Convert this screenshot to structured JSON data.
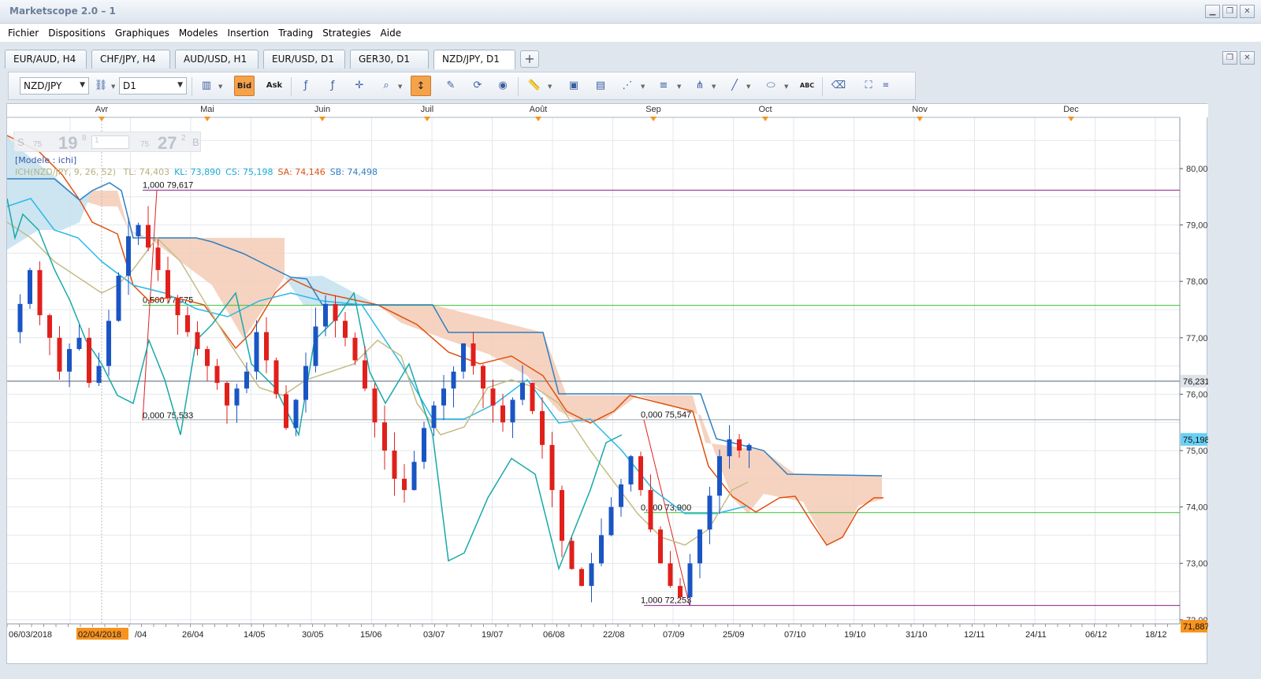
{
  "window": {
    "title": "Marketscope 2.0 – 1"
  },
  "menu": [
    "Fichier",
    "Dispositions",
    "Graphiques",
    "Modeles",
    "Insertion",
    "Trading",
    "Strategies",
    "Aide"
  ],
  "tabs": [
    "EUR/AUD, H4",
    "CHF/JPY, H4",
    "AUD/USD, H1",
    "EUR/USD, D1",
    "GER30, D1",
    "NZD/JPY, D1"
  ],
  "active_tab": 5,
  "toolbar": {
    "symbol": "NZD/JPY",
    "timeframe": "D1",
    "bid_label": "Bid",
    "ask_label": "Ask"
  },
  "spread_panel": {
    "sell_label": "S",
    "buy_label": "B",
    "sell_small": "75",
    "sell_big": "19",
    "sell_sup": "8",
    "buy_small": "75",
    "buy_big": "27",
    "buy_sup": "2",
    "quantity": "1"
  },
  "indicator": {
    "model": "[Modele : ichi]",
    "name": "ICH(NZD/JPY, 9, 26, 52)",
    "values": [
      {
        "label": "TL: 74,403",
        "color": "#b8b27a"
      },
      {
        "label": "KL: 73,890",
        "color": "#1aa9d8"
      },
      {
        "label": "CS: 75,198",
        "color": "#1aa9d8"
      },
      {
        "label": "SA: 74,146",
        "color": "#e0500f"
      },
      {
        "label": "SB: 74,498",
        "color": "#2f7fc1"
      }
    ]
  },
  "price_axis": {
    "labels": [
      "80,00",
      "79,00",
      "78,00",
      "77,00",
      "76,00",
      "75,00",
      "74,00",
      "73,00",
      "72,00"
    ],
    "markers": [
      {
        "label": "76,231",
        "value": 76.231,
        "bg": "#dfe4ea",
        "fg": "#111"
      },
      {
        "label": "75,198",
        "value": 75.198,
        "bg": "#6ad0f5",
        "fg": "#111"
      },
      {
        "label": "71,887",
        "value": 71.887,
        "bg": "#f7931e",
        "fg": "#111"
      }
    ]
  },
  "month_labels": [
    "Avr",
    "Mai",
    "Juin",
    "Juil",
    "Août",
    "Sep",
    "Oct",
    "Nov",
    "Dec"
  ],
  "date_labels": [
    "06/03/2018",
    "02/04/2018",
    "/04",
    "26/04",
    "14/05",
    "30/05",
    "15/06",
    "03/07",
    "19/07",
    "06/08",
    "22/08",
    "07/09",
    "25/09",
    "07/10",
    "19/10",
    "31/10",
    "12/11",
    "24/11",
    "06/12",
    "18/12"
  ],
  "highlighted_date": "02/04/2018",
  "fib_labels": [
    "1,000 79,617",
    "0,500 77,575",
    "0,000 75,533",
    "0,000 75,547",
    "0,500 73,900",
    "1,000 72,253"
  ],
  "colors": {
    "bull": "#1a55c4",
    "bear": "#e0201b",
    "tenkan": "#c4bd86",
    "kijun": "#29b8e6",
    "chikou": "#17a8a8",
    "senkou_a": "#e0500f",
    "senkou_b": "#2f7fc1",
    "cloud_bear": "#f3cbb5",
    "cloud_bull": "#c7e2f0",
    "fib_hi": "#8b1e8b",
    "fib_mid": "#35c235"
  }
}
